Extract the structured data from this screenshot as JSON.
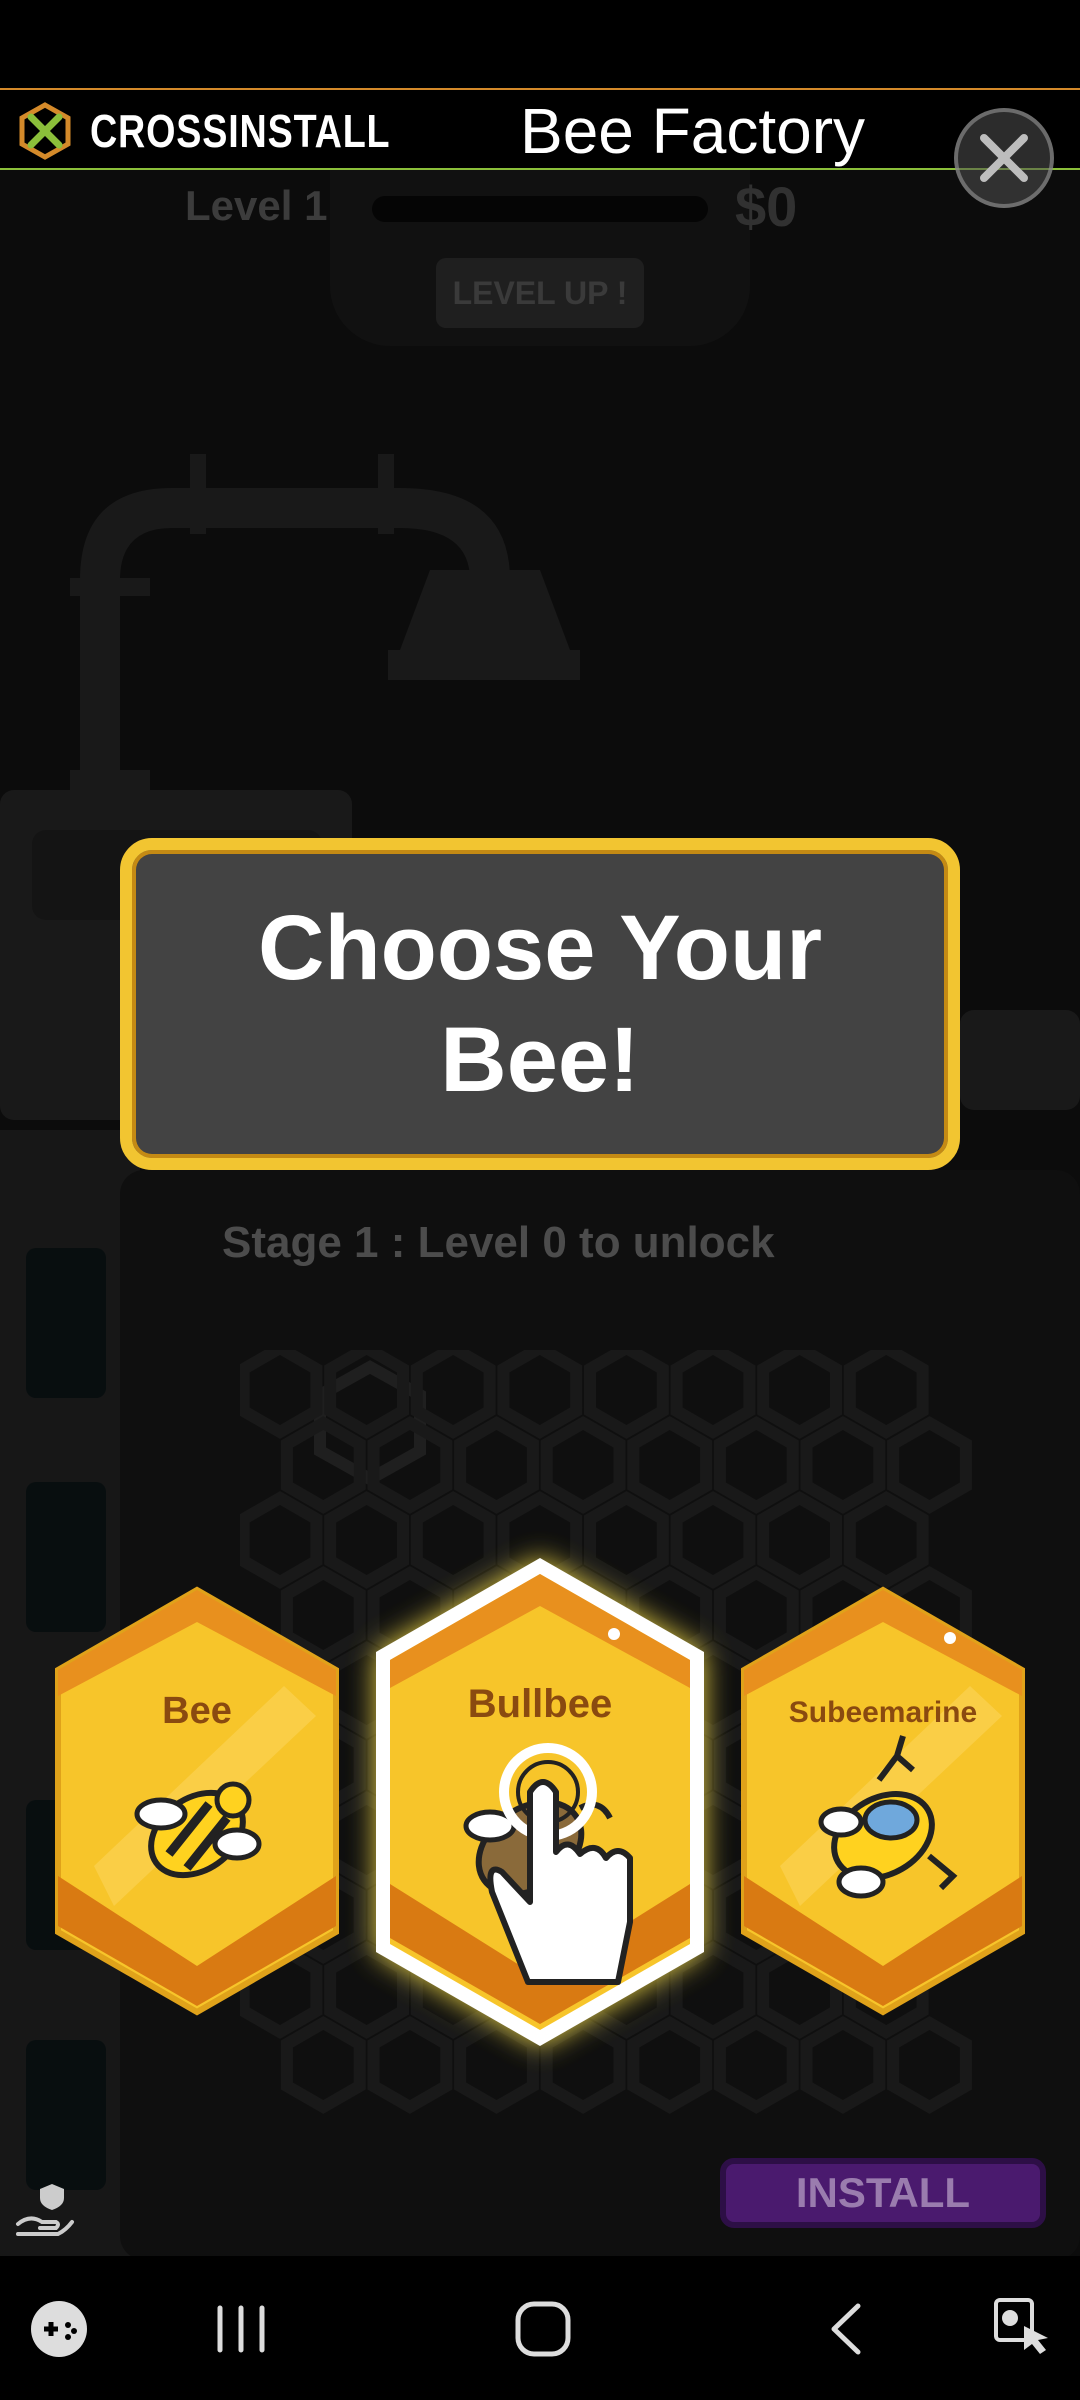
{
  "ad": {
    "brand": "CROSSINSTALL",
    "title": "Bee Factory",
    "brand_color": "#d48a2a",
    "accent_color": "#8bbf3a"
  },
  "hud": {
    "level": "Level 1",
    "money": "$0",
    "level_up": "LEVEL UP !",
    "progress_fraction": 0
  },
  "dialog": {
    "title": "Choose Your Bee!"
  },
  "stage": {
    "text": "Stage 1 : Level 0 to unlock"
  },
  "bees": [
    {
      "name": "Bee",
      "icon": "bee-icon",
      "selected": false
    },
    {
      "name": "Bullbee",
      "icon": "bullbee-icon",
      "selected": true
    },
    {
      "name": "Subeemarine",
      "icon": "subeemarine-icon",
      "selected": false
    }
  ],
  "install": {
    "label": "INSTALL"
  },
  "nav": {
    "icons": [
      "game-launcher-icon",
      "recent-apps-icon",
      "home-icon",
      "back-icon",
      "keyboard-icon"
    ]
  }
}
